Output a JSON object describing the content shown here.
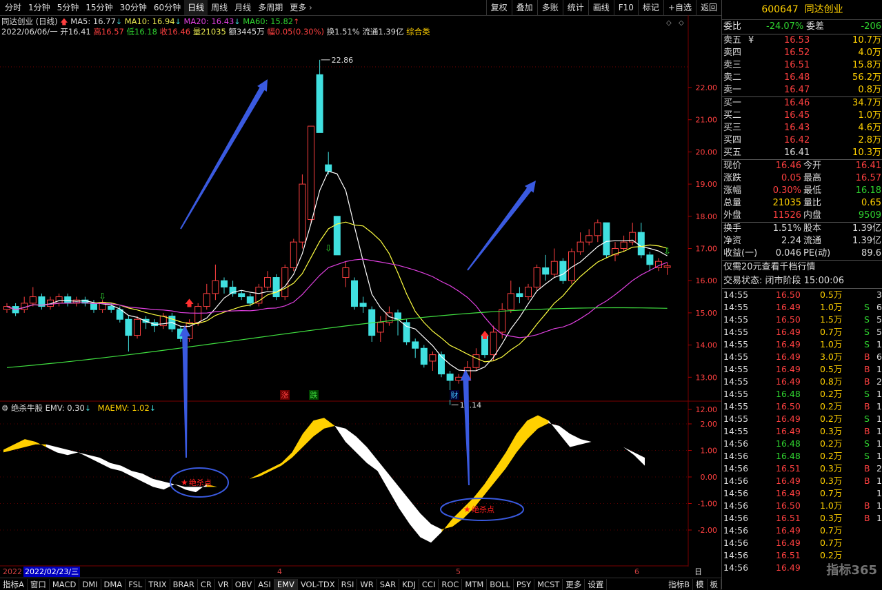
{
  "toolbar": {
    "periods": [
      "分时",
      "1分钟",
      "5分钟",
      "15分钟",
      "30分钟",
      "60分钟",
      "日线",
      "周线",
      "月线",
      "多周期",
      "更多"
    ],
    "active_period": "日线",
    "tools": [
      "复权",
      "叠加",
      "多账",
      "统计",
      "画线",
      "F10",
      "标记",
      "+自选",
      "返回"
    ]
  },
  "stock": {
    "name": "同达创业",
    "code": "600647",
    "chart_title": "同达创业 (日线)"
  },
  "ma_line": {
    "ma5": "MA5: 16.77",
    "ma10": "MA10: 16.94",
    "ma20": "MA20: 16.43",
    "ma60": "MA60: 15.82"
  },
  "bar_info": {
    "date": "2022/06/06/一",
    "open": "开16.41",
    "high": "高16.57",
    "low": "低16.18",
    "close": "收16.46",
    "volume": "量21035",
    "amount": "额3445万",
    "change": "幅0.05(0.30%)",
    "turnover": "换1.51%",
    "float": "流通1.39亿",
    "sector": "综合类"
  },
  "price_axis": [
    "22.00",
    "21.00",
    "20.00",
    "19.00",
    "18.00",
    "17.00",
    "16.00",
    "15.00",
    "14.00",
    "13.00",
    "12.00"
  ],
  "high_label": "22.86",
  "low_label": "12.14",
  "event_labels": {
    "limit_up": "涨",
    "limit_down": "跌",
    "finance": "财"
  },
  "indicator": {
    "name": "绝杀牛股",
    "emv": "EMV: 0.30",
    "maemv": "MAEMV: 1.02",
    "axis": [
      "2.00",
      "1.00",
      "0.00",
      "-1.00",
      "-2.00"
    ],
    "signal_label": "绝杀点",
    "signal_label_2": "绝杀点"
  },
  "date_axis": {
    "selected": "2022/02/23/三",
    "year": "2022",
    "months": [
      "4",
      "5",
      "6"
    ],
    "period_label": "日线"
  },
  "bottom_tabs": [
    "指标A",
    "窗口",
    "MACD",
    "DMI",
    "DMA",
    "FSL",
    "TRIX",
    "BRAR",
    "CR",
    "VR",
    "OBV",
    "ASI",
    "EMV",
    "VOL-TDX",
    "RSI",
    "WR",
    "SAR",
    "KDJ",
    "CCI",
    "ROC",
    "MTM",
    "BOLL",
    "PSY",
    "MCST",
    "更多",
    "设置"
  ],
  "bottom_right": [
    "指标B",
    "模",
    "板"
  ],
  "quote": {
    "weibi_label": "委比",
    "weibi": "-24.07%",
    "weicha_label": "委差",
    "weicha": "-206",
    "asks": [
      {
        "label": "卖五",
        "price": "16.53",
        "vol": "10.7万"
      },
      {
        "label": "卖四",
        "price": "16.52",
        "vol": "4.0万"
      },
      {
        "label": "卖三",
        "price": "16.51",
        "vol": "15.8万"
      },
      {
        "label": "卖二",
        "price": "16.48",
        "vol": "56.2万"
      },
      {
        "label": "卖一",
        "price": "16.47",
        "vol": "0.8万"
      }
    ],
    "ask5_symbol": "¥",
    "bids": [
      {
        "label": "买一",
        "price": "16.46",
        "vol": "34.7万"
      },
      {
        "label": "买二",
        "price": "16.45",
        "vol": "1.0万"
      },
      {
        "label": "买三",
        "price": "16.43",
        "vol": "4.6万"
      },
      {
        "label": "买四",
        "price": "16.42",
        "vol": "2.8万"
      },
      {
        "label": "买五",
        "price": "16.41",
        "vol": "10.3万"
      }
    ],
    "stats": [
      {
        "l1": "现价",
        "v1": "16.46",
        "l2": "今开",
        "v2": "16.41"
      },
      {
        "l1": "涨跌",
        "v1": "0.05",
        "l2": "最高",
        "v2": "16.57"
      },
      {
        "l1": "涨幅",
        "v1": "0.30%",
        "l2": "最低",
        "v2": "16.18"
      },
      {
        "l1": "总量",
        "v1": "21035",
        "l2": "量比",
        "v2": "0.65"
      },
      {
        "l1": "外盘",
        "v1": "11526",
        "l2": "内盘",
        "v2": "9509"
      }
    ],
    "stats2": [
      {
        "l1": "换手",
        "v1": "1.51%",
        "l2": "股本",
        "v2": "1.39亿"
      },
      {
        "l1": "净资",
        "v1": "2.24",
        "l2": "流通",
        "v2": "1.39亿"
      },
      {
        "l1": "收益(一)",
        "v1": "0.046",
        "l2": "PE(动)",
        "v2": "89.6"
      }
    ],
    "promo": "仅需20元查看千档行情",
    "status": "交易状态: 闭市阶段 15:00:06"
  },
  "ticks": [
    {
      "t": "14:55",
      "p": "16.50",
      "v": "0.5万",
      "d": "",
      "n": "3"
    },
    {
      "t": "14:55",
      "p": "16.49",
      "v": "1.0万",
      "d": "S",
      "n": "6"
    },
    {
      "t": "14:55",
      "p": "16.50",
      "v": "1.5万",
      "d": "S",
      "n": "5"
    },
    {
      "t": "14:55",
      "p": "16.49",
      "v": "0.7万",
      "d": "S",
      "n": "5"
    },
    {
      "t": "14:55",
      "p": "16.49",
      "v": "1.0万",
      "d": "S",
      "n": "1"
    },
    {
      "t": "14:55",
      "p": "16.49",
      "v": "3.0万",
      "d": "B",
      "n": "6"
    },
    {
      "t": "14:55",
      "p": "16.49",
      "v": "0.5万",
      "d": "B",
      "n": "1"
    },
    {
      "t": "14:55",
      "p": "16.49",
      "v": "0.8万",
      "d": "B",
      "n": "2"
    },
    {
      "t": "14:55",
      "p": "16.48",
      "v": "0.2万",
      "d": "S",
      "n": "1"
    },
    {
      "t": "14:55",
      "p": "16.50",
      "v": "0.2万",
      "d": "B",
      "n": "1"
    },
    {
      "t": "14:55",
      "p": "16.49",
      "v": "0.2万",
      "d": "S",
      "n": "1"
    },
    {
      "t": "14:55",
      "p": "16.49",
      "v": "0.3万",
      "d": "B",
      "n": "1"
    },
    {
      "t": "14:56",
      "p": "16.48",
      "v": "0.2万",
      "d": "S",
      "n": "1"
    },
    {
      "t": "14:56",
      "p": "16.48",
      "v": "0.2万",
      "d": "S",
      "n": "1"
    },
    {
      "t": "14:56",
      "p": "16.51",
      "v": "0.3万",
      "d": "B",
      "n": "2"
    },
    {
      "t": "14:56",
      "p": "16.49",
      "v": "0.3万",
      "d": "B",
      "n": "1"
    },
    {
      "t": "14:56",
      "p": "16.49",
      "v": "0.7万",
      "d": "",
      "n": "1"
    },
    {
      "t": "14:56",
      "p": "16.50",
      "v": "1.0万",
      "d": "B",
      "n": "1"
    },
    {
      "t": "14:56",
      "p": "16.51",
      "v": "0.3万",
      "d": "B",
      "n": "1"
    },
    {
      "t": "14:56",
      "p": "16.49",
      "v": "0.7万",
      "d": "",
      "n": ""
    },
    {
      "t": "14:56",
      "p": "16.49",
      "v": "0.7万",
      "d": "",
      "n": ""
    },
    {
      "t": "14:56",
      "p": "16.51",
      "v": "0.2万",
      "d": "",
      "n": ""
    },
    {
      "t": "14:56",
      "p": "16.49",
      "v": "",
      "d": "",
      "n": ""
    }
  ],
  "watermark": "指标365",
  "colors": {
    "up": "#ff4040",
    "down": "#40e0e0",
    "ma5": "#ffffff",
    "ma10": "#ffff40",
    "ma20": "#e040e0",
    "ma60": "#40e040",
    "ind_pos": "#ffd000",
    "ind_neg": "#ffffff"
  }
}
